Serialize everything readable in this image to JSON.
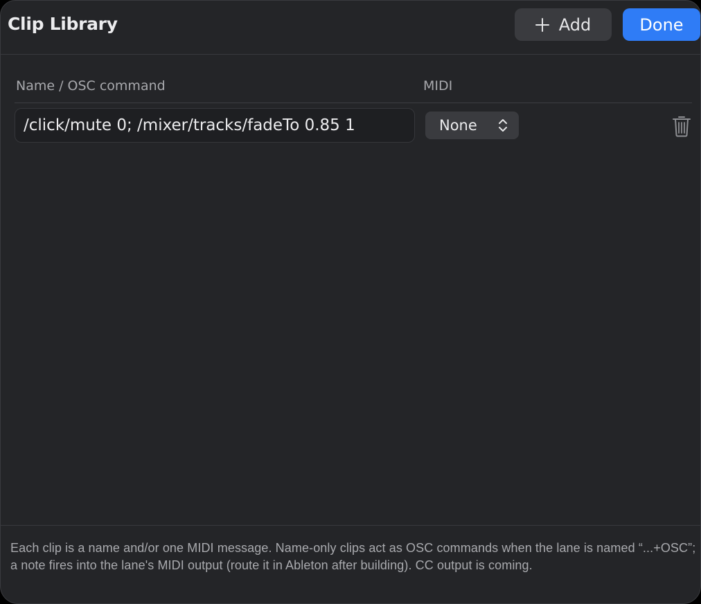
{
  "window": {
    "title": "Clip Library"
  },
  "toolbar": {
    "add_label": "Add",
    "add_icon": "plus-icon",
    "done_label": "Done",
    "done_color": "#2f7cf6"
  },
  "table": {
    "columns": [
      "Name / OSC command",
      "MIDI"
    ],
    "rows": [
      {
        "name_value": "/click/mute 0; /mixer/tracks/fadeTo 0.85 1",
        "midi_selected": "None",
        "delete_icon": "trash-icon"
      }
    ]
  },
  "footer": {
    "help_text": "Each clip is a name and/or one MIDI message. Name-only clips act as OSC commands when the lane is named “...+OSC”; a note fires into the lane's MIDI output (route it in Ableton after building). CC output is coming."
  }
}
